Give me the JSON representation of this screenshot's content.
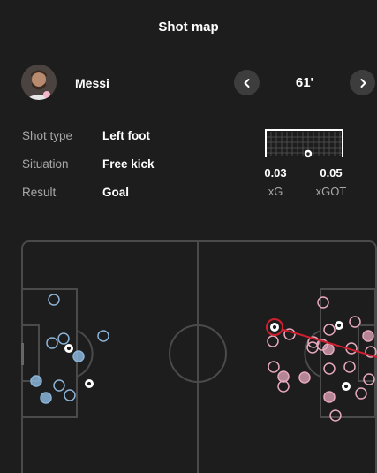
{
  "header": {
    "title": "Shot map"
  },
  "player": {
    "name": "Messi",
    "avatar_icon": "player-photo"
  },
  "navigation": {
    "minute": "61'",
    "prev_icon": "chevron-left-icon",
    "next_icon": "chevron-right-icon"
  },
  "details": [
    {
      "label": "Shot type",
      "value": "Left foot"
    },
    {
      "label": "Situation",
      "value": "Free kick"
    },
    {
      "label": "Result",
      "value": "Goal"
    }
  ],
  "stats": [
    {
      "value": "0.03",
      "label": "xG"
    },
    {
      "value": "0.05",
      "label": "xGOT"
    }
  ],
  "colors": {
    "background": "#1d1d1d",
    "pitch_line": "#4a4a4a",
    "team_left": "#8ab4d8",
    "team_right": "#e6a8bd",
    "selected_ring": "#d01f2f",
    "shot_trajectory": "#d01f2f"
  },
  "shot_map": {
    "selected_shot": "goal"
  }
}
